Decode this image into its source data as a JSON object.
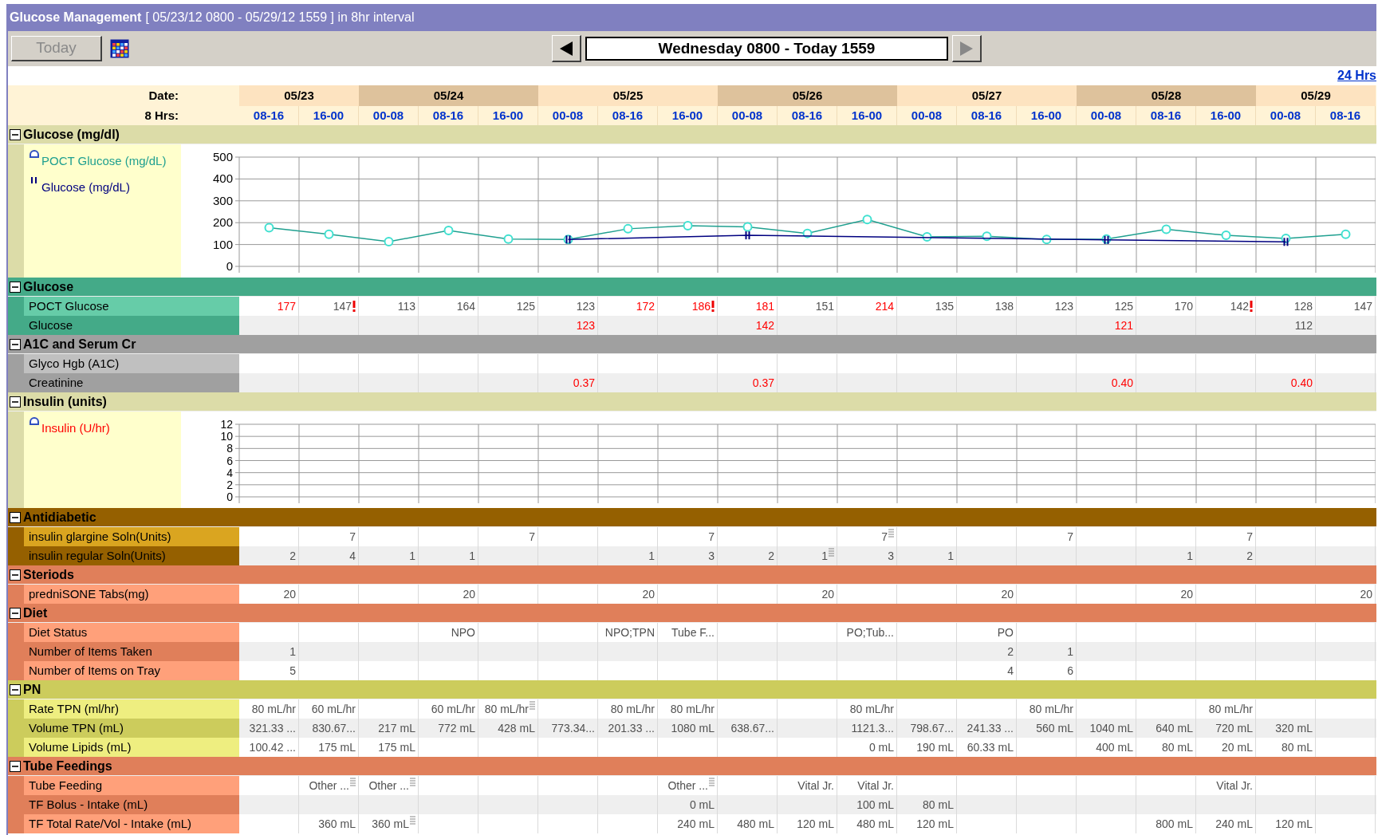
{
  "window": {
    "title": "Glucose Management",
    "range": "[ 05/23/12 0800 - 05/29/12 1559 ] in 8hr interval"
  },
  "toolbar": {
    "today_button": {
      "label": "Today",
      "disabled": true
    },
    "range_field": {
      "value": "Wednesday 0800 - Today 1559"
    },
    "prev_disabled": false,
    "next_disabled": true
  },
  "link": "24 Hrs",
  "header": {
    "date_label": "Date:",
    "shift_label": "8 Hrs:",
    "dates": [
      {
        "label": "05/23",
        "shifts": [
          "08-16",
          "16-00"
        ]
      },
      {
        "label": "05/24",
        "shifts": [
          "00-08",
          "08-16",
          "16-00"
        ]
      },
      {
        "label": "05/25",
        "shifts": [
          "00-08",
          "08-16",
          "16-00"
        ]
      },
      {
        "label": "05/26",
        "shifts": [
          "00-08",
          "08-16",
          "16-00"
        ]
      },
      {
        "label": "05/27",
        "shifts": [
          "00-08",
          "08-16",
          "16-00"
        ]
      },
      {
        "label": "05/28",
        "shifts": [
          "00-08",
          "08-16",
          "16-00"
        ]
      },
      {
        "label": "05/29",
        "shifts": [
          "00-08",
          "08-16"
        ]
      }
    ]
  },
  "sections": [
    {
      "kind": "chart",
      "title": "Glucose (mg/dl)",
      "expanded": true,
      "color": "#dcdca8",
      "chart_data": {
        "type": "line",
        "grid": true,
        "ylim": [
          0,
          500
        ],
        "yticks": [
          0,
          100,
          200,
          300,
          400,
          500
        ],
        "series": [
          {
            "name": "POCT Glucose (mg/dL)",
            "color": "#20a090",
            "marker": "circle",
            "values": [
              177,
              147,
              113,
              164,
              125,
              123,
              172,
              186,
              181,
              151,
              214,
              135,
              138,
              123,
              125,
              170,
              142,
              128,
              147
            ]
          },
          {
            "name": "Glucose (mg/dL)",
            "color": "#000080",
            "values": [
              null,
              null,
              null,
              null,
              null,
              123,
              null,
              null,
              142,
              null,
              null,
              null,
              null,
              null,
              121,
              null,
              null,
              112,
              null
            ]
          }
        ]
      }
    },
    {
      "kind": "table",
      "title": "Glucose",
      "expanded": true,
      "color": "#44aa88",
      "rows": [
        {
          "label": "POCT Glucose",
          "color": "#66cca8",
          "cells": [
            {
              "text": "177",
              "red": true
            },
            {
              "text": "147",
              "alert": true
            },
            {
              "text": "113"
            },
            {
              "text": "164"
            },
            {
              "text": "125"
            },
            {
              "text": "123"
            },
            {
              "text": "172",
              "red": true
            },
            {
              "text": "186",
              "red": true,
              "alert": true
            },
            {
              "text": "181",
              "red": true
            },
            {
              "text": "151"
            },
            {
              "text": "214",
              "red": true
            },
            {
              "text": "135"
            },
            {
              "text": "138"
            },
            {
              "text": "123"
            },
            {
              "text": "125"
            },
            {
              "text": "170"
            },
            {
              "text": "142",
              "alert": true
            },
            {
              "text": "128"
            },
            {
              "text": "147"
            }
          ]
        },
        {
          "label": "Glucose",
          "color": "#44aa88",
          "cells": [
            null,
            null,
            null,
            null,
            null,
            {
              "text": "123",
              "red": true
            },
            null,
            null,
            {
              "text": "142",
              "red": true
            },
            null,
            null,
            null,
            null,
            null,
            {
              "text": "121",
              "red": true
            },
            null,
            null,
            {
              "text": "112"
            },
            null
          ]
        }
      ]
    },
    {
      "kind": "table",
      "title": "A1C and Serum Cr",
      "expanded": true,
      "color": "#a0a0a0",
      "rows": [
        {
          "label": "Glyco Hgb (A1C)",
          "color": "#c0c0c0",
          "cells": [
            null,
            null,
            null,
            null,
            null,
            null,
            null,
            null,
            null,
            null,
            null,
            null,
            null,
            null,
            null,
            null,
            null,
            null,
            null
          ]
        },
        {
          "label": "Creatinine",
          "color": "#a0a0a0",
          "cells": [
            null,
            null,
            null,
            null,
            null,
            {
              "text": "0.37",
              "red": true
            },
            null,
            null,
            {
              "text": "0.37",
              "red": true
            },
            null,
            null,
            null,
            null,
            null,
            {
              "text": "0.40",
              "red": true
            },
            null,
            null,
            {
              "text": "0.40",
              "red": true
            },
            null
          ]
        }
      ]
    },
    {
      "kind": "chart",
      "title": "Insulin (units)",
      "expanded": true,
      "color": "#dcdca8",
      "chart_data": {
        "type": "line",
        "grid": true,
        "ylim": [
          0,
          12
        ],
        "yticks": [
          0,
          2,
          4,
          6,
          8,
          10,
          12
        ],
        "series": [
          {
            "name": "Insulin (U/hr)",
            "color": "#ff0000",
            "marker": "circle",
            "values": [
              null,
              null,
              null,
              null,
              null,
              null,
              null,
              null,
              null,
              null,
              null,
              null,
              null,
              null,
              null,
              null,
              null,
              null,
              null
            ]
          }
        ]
      }
    },
    {
      "kind": "table",
      "title": "Antidiabetic",
      "expanded": true,
      "color": "#956000",
      "rows": [
        {
          "label": "insulin glargine Soln(Units)",
          "color": "#daa520",
          "cells": [
            null,
            {
              "text": "7"
            },
            null,
            null,
            {
              "text": "7"
            },
            null,
            null,
            {
              "text": "7"
            },
            null,
            null,
            {
              "text": "7",
              "note": true
            },
            null,
            null,
            {
              "text": "7"
            },
            null,
            null,
            {
              "text": "7"
            },
            null,
            null
          ]
        },
        {
          "label": "insulin regular Soln(Units)",
          "color": "#956000",
          "cells": [
            {
              "text": "2"
            },
            {
              "text": "4"
            },
            {
              "text": "1"
            },
            {
              "text": "1"
            },
            null,
            null,
            {
              "text": "1"
            },
            {
              "text": "3"
            },
            {
              "text": "2"
            },
            {
              "text": "1",
              "note": true
            },
            {
              "text": "3"
            },
            {
              "text": "1"
            },
            null,
            null,
            null,
            {
              "text": "1"
            },
            {
              "text": "2"
            },
            null,
            null
          ]
        }
      ]
    },
    {
      "kind": "table",
      "title": "Steriods",
      "expanded": true,
      "color": "#e07f5a",
      "rows": [
        {
          "label": "predniSONE Tabs(mg)",
          "color": "#ffa07a",
          "cells": [
            {
              "text": "20"
            },
            null,
            null,
            {
              "text": "20"
            },
            null,
            null,
            {
              "text": "20"
            },
            null,
            null,
            {
              "text": "20"
            },
            null,
            null,
            {
              "text": "20"
            },
            null,
            null,
            {
              "text": "20"
            },
            null,
            null,
            {
              "text": "20"
            }
          ]
        }
      ]
    },
    {
      "kind": "table",
      "title": "Diet",
      "expanded": true,
      "color": "#e07f5a",
      "rows": [
        {
          "label": "Diet Status",
          "color": "#ffa07a",
          "cells": [
            null,
            null,
            null,
            {
              "text": "NPO"
            },
            null,
            null,
            {
              "text": "NPO;TPN"
            },
            {
              "text": "Tube F..."
            },
            null,
            null,
            {
              "text": "PO;Tub..."
            },
            null,
            {
              "text": "PO"
            },
            null,
            null,
            null,
            null,
            null,
            null
          ]
        },
        {
          "label": "Number of Items Taken",
          "color": "#e07f5a",
          "cells": [
            {
              "text": "1"
            },
            null,
            null,
            null,
            null,
            null,
            null,
            null,
            null,
            null,
            null,
            null,
            {
              "text": "2"
            },
            {
              "text": "1"
            },
            null,
            null,
            null,
            null,
            null
          ]
        },
        {
          "label": "Number of Items on Tray",
          "color": "#ffa07a",
          "cells": [
            {
              "text": "5"
            },
            null,
            null,
            null,
            null,
            null,
            null,
            null,
            null,
            null,
            null,
            null,
            {
              "text": "4"
            },
            {
              "text": "6"
            },
            null,
            null,
            null,
            null,
            null
          ]
        }
      ]
    },
    {
      "kind": "table",
      "title": "PN",
      "expanded": true,
      "color": "#cccc5c",
      "rows": [
        {
          "label": "Rate TPN (ml/hr)",
          "color": "#eeee80",
          "cells": [
            {
              "text": "80 mL/hr"
            },
            {
              "text": "60 mL/hr"
            },
            null,
            {
              "text": "60 mL/hr"
            },
            {
              "text": "80 mL/hr",
              "note": true
            },
            null,
            {
              "text": "80 mL/hr"
            },
            {
              "text": "80 mL/hr"
            },
            null,
            null,
            {
              "text": "80 mL/hr"
            },
            null,
            null,
            {
              "text": "80 mL/hr"
            },
            null,
            null,
            {
              "text": "80 mL/hr"
            },
            null,
            null
          ]
        },
        {
          "label": "Volume TPN (mL)",
          "color": "#cccc5c",
          "cells": [
            {
              "text": "321.33 ..."
            },
            {
              "text": "830.67..."
            },
            {
              "text": "217 mL"
            },
            {
              "text": "772 mL"
            },
            {
              "text": "428 mL"
            },
            {
              "text": "773.34..."
            },
            {
              "text": "201.33 ..."
            },
            {
              "text": "1080 mL"
            },
            {
              "text": "638.67..."
            },
            null,
            {
              "text": "1121.3..."
            },
            {
              "text": "798.67..."
            },
            {
              "text": "241.33 ..."
            },
            {
              "text": "560 mL"
            },
            {
              "text": "1040 mL"
            },
            {
              "text": "640 mL"
            },
            {
              "text": "720 mL"
            },
            {
              "text": "320 mL"
            },
            null
          ]
        },
        {
          "label": "Volume Lipids (mL)",
          "color": "#eeee80",
          "cells": [
            {
              "text": "100.42 ..."
            },
            {
              "text": "175 mL"
            },
            {
              "text": "175 mL"
            },
            null,
            null,
            null,
            null,
            null,
            null,
            null,
            {
              "text": "0 mL"
            },
            {
              "text": "190 mL"
            },
            {
              "text": "60.33 mL"
            },
            null,
            {
              "text": "400 mL"
            },
            {
              "text": "80 mL"
            },
            {
              "text": "20 mL"
            },
            {
              "text": "80 mL"
            },
            null
          ]
        }
      ]
    },
    {
      "kind": "table",
      "title": "Tube Feedings",
      "expanded": true,
      "color": "#e07f5a",
      "rows": [
        {
          "label": "Tube Feeding",
          "color": "#ffa07a",
          "cells": [
            null,
            {
              "text": "Other ...",
              "note": true
            },
            {
              "text": "Other ...",
              "note": true
            },
            null,
            null,
            null,
            null,
            {
              "text": "Other ...",
              "note": true
            },
            null,
            {
              "text": "Vital Jr."
            },
            {
              "text": "Vital Jr."
            },
            null,
            null,
            null,
            null,
            null,
            {
              "text": "Vital Jr."
            },
            null,
            null
          ]
        },
        {
          "label": "TF Bolus - Intake (mL)",
          "color": "#e07f5a",
          "cells": [
            null,
            null,
            null,
            null,
            null,
            null,
            null,
            {
              "text": "0 mL"
            },
            null,
            null,
            {
              "text": "100 mL"
            },
            {
              "text": "80 mL"
            },
            null,
            null,
            null,
            null,
            null,
            null,
            null
          ]
        },
        {
          "label": "TF Total Rate/Vol - Intake (mL)",
          "color": "#ffa07a",
          "cells": [
            null,
            {
              "text": "360 mL"
            },
            {
              "text": "360 mL",
              "note": true
            },
            null,
            null,
            null,
            null,
            {
              "text": "240 mL"
            },
            {
              "text": "480 mL"
            },
            {
              "text": "120 mL"
            },
            {
              "text": "480 mL"
            },
            {
              "text": "120 mL"
            },
            null,
            null,
            null,
            {
              "text": "800 mL"
            },
            {
              "text": "240 mL"
            },
            {
              "text": "120 mL"
            },
            null
          ]
        }
      ]
    }
  ]
}
